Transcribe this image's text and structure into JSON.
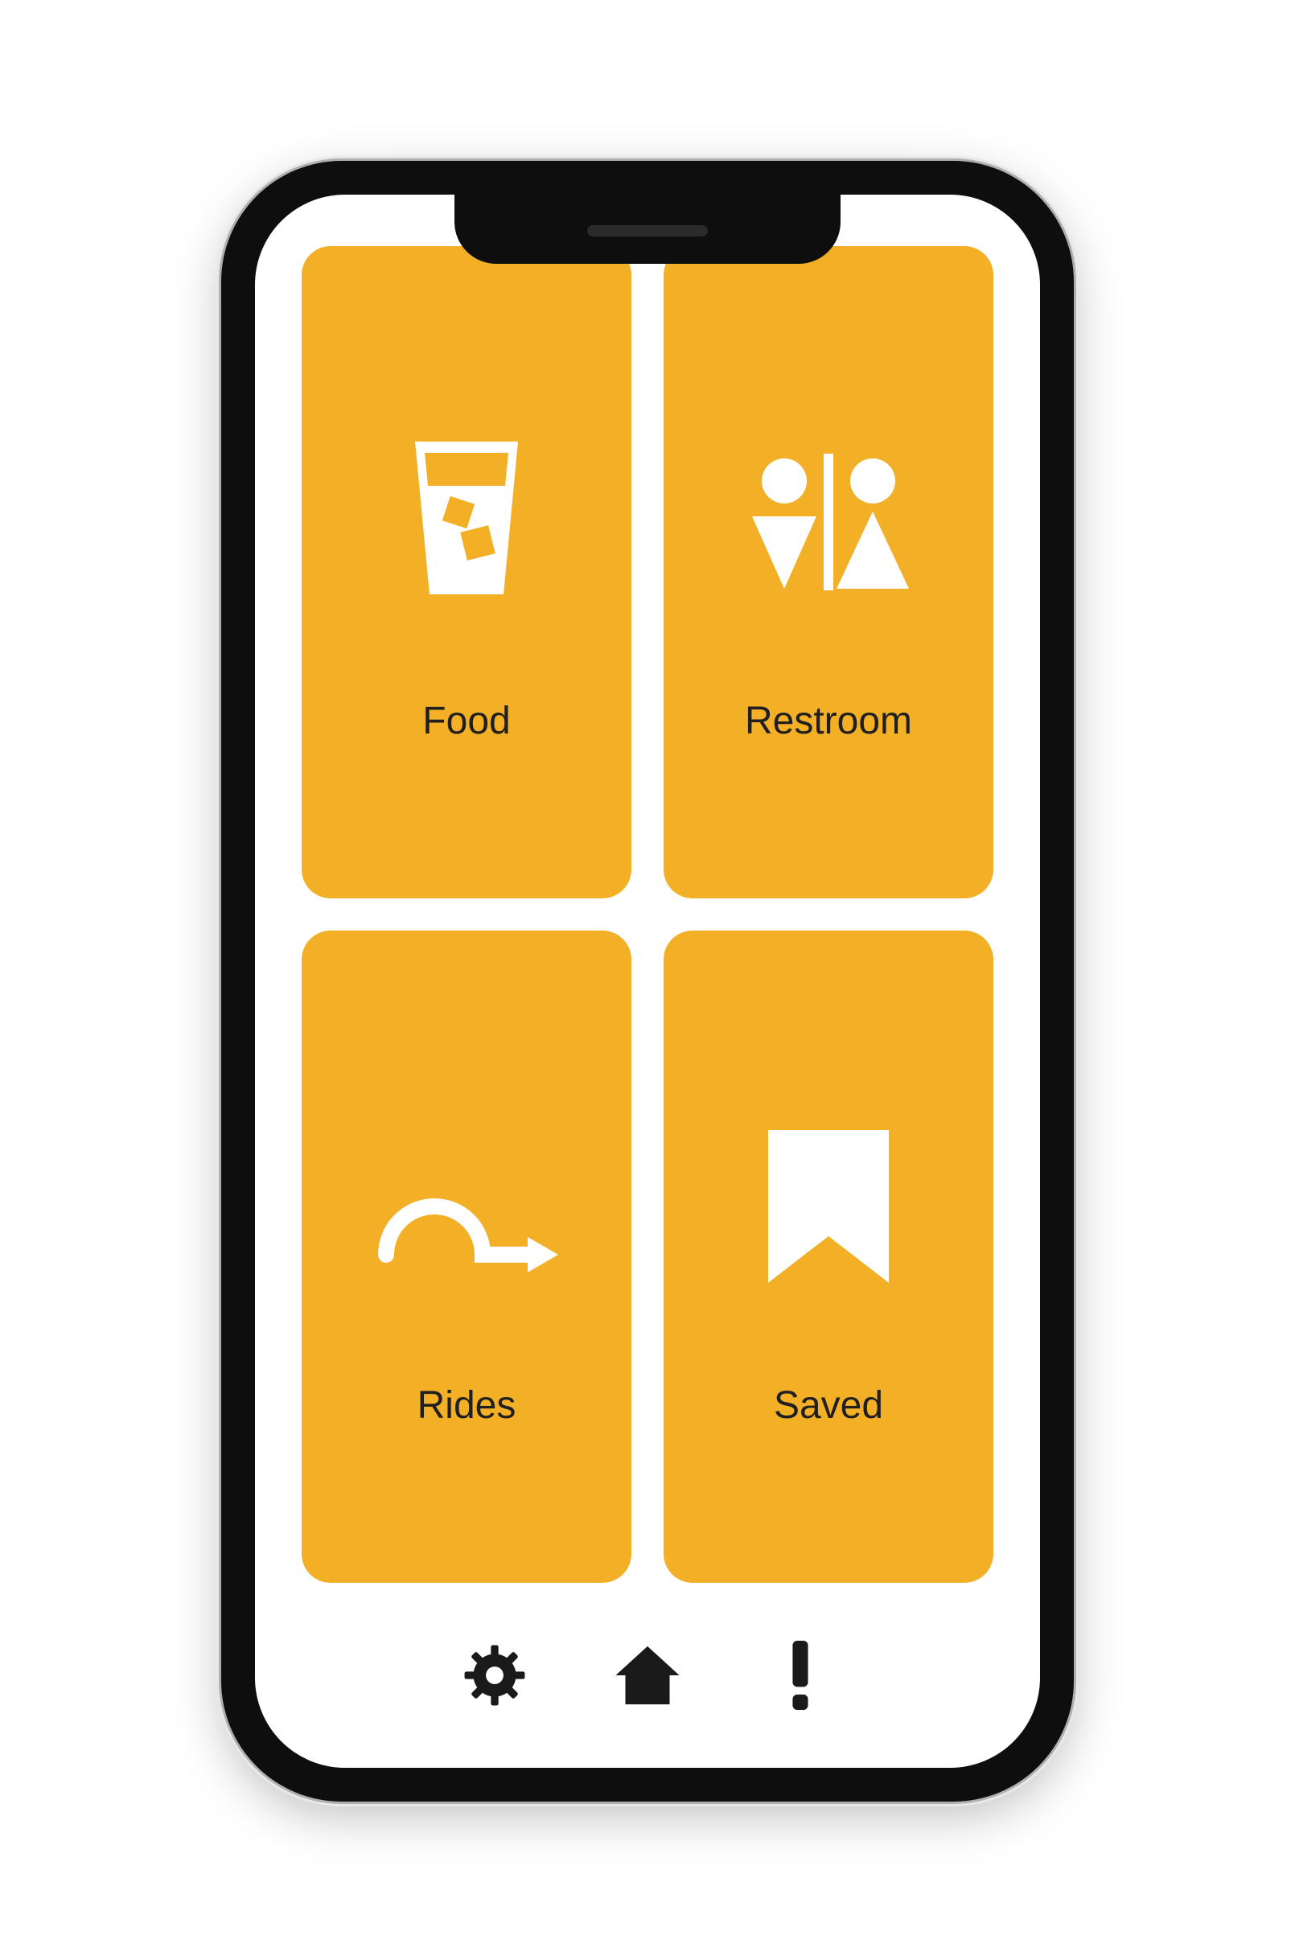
{
  "colors": {
    "tile_bg": "#f3af25",
    "tile_icon": "#ffffff",
    "tile_label": "#1f1f1f",
    "phone_body": "#0e0e0e",
    "nav_icon": "#1a1a1a"
  },
  "tiles": [
    {
      "id": "food",
      "label": "Food",
      "icon": "drink-icon"
    },
    {
      "id": "restroom",
      "label": "Restroom",
      "icon": "restroom-icon"
    },
    {
      "id": "rides",
      "label": "Rides",
      "icon": "loop-arrow-icon"
    },
    {
      "id": "saved",
      "label": "Saved",
      "icon": "bookmark-icon"
    }
  ],
  "bottom_nav": [
    {
      "id": "settings",
      "icon": "gear-icon"
    },
    {
      "id": "home",
      "icon": "home-icon"
    },
    {
      "id": "alerts",
      "icon": "alert-icon"
    }
  ]
}
